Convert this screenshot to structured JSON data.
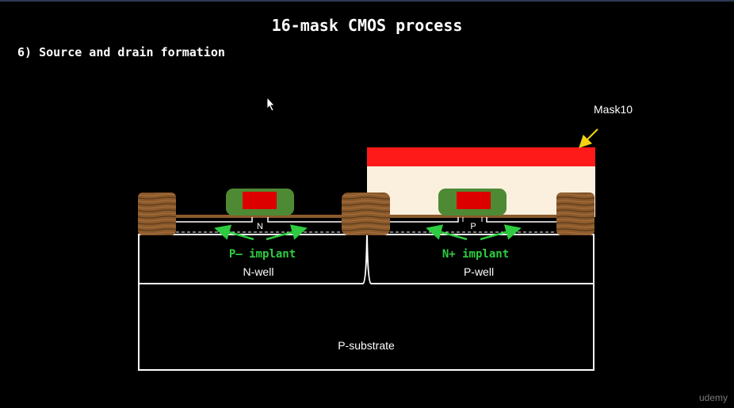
{
  "header": {
    "title": "16-mask CMOS process",
    "subtitle": "6) Source and drain formation"
  },
  "diagram": {
    "mask_label": "Mask10",
    "n_label": "N",
    "p_label": "P",
    "p_implant": "P– implant",
    "n_implant": "N+ implant",
    "nwell": "N-well",
    "pwell": "P-well",
    "substrate": "P-substrate"
  },
  "watermark": "udemy",
  "colors": {
    "mask": "#ff1a1a",
    "photoresist": "#fbf0de",
    "spacer": "#4e8a34",
    "gate": "#dd0000",
    "field_oxide": "#7a4a24",
    "implant_arrow": "#2ecc40",
    "mask_arrow": "#f3d20f"
  }
}
